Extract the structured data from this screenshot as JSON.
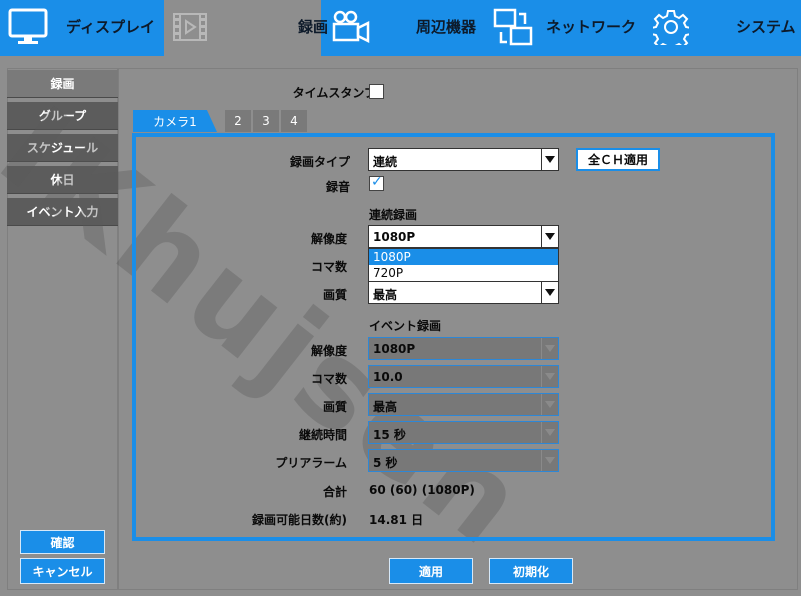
{
  "topbar": {
    "tabs": [
      {
        "label": "ディスプレイ",
        "icon": "monitor-icon"
      },
      {
        "label": "録画",
        "icon": "film-icon"
      },
      {
        "label": "周辺機器",
        "icon": "camera-icon"
      },
      {
        "label": "ネットワーク",
        "icon": "network-icon"
      },
      {
        "label": "システム",
        "icon": "gear-icon"
      }
    ],
    "active": "録画",
    "accent": "#1a8ee8"
  },
  "sidebar": {
    "items": [
      {
        "label": "録画"
      },
      {
        "label": "グループ"
      },
      {
        "label": "スケジュール"
      },
      {
        "label": "休日"
      },
      {
        "label": "イベント入力"
      }
    ],
    "confirm_label": "確認",
    "cancel_label": "キャンセル"
  },
  "main": {
    "timestamp_label": "タイムスタンプ",
    "timestamp_checked": false,
    "camera_tabs": [
      "カメラ1",
      "2",
      "3",
      "4"
    ],
    "record_type_label": "録画タイプ",
    "record_type_value": "連続",
    "apply_all_label": "全ＣＨ適用",
    "audio_label": "録音",
    "audio_checked": true,
    "continuous": {
      "heading": "連続録画",
      "resolution_label": "解像度",
      "resolution_value": "1080P",
      "resolution_options": [
        "1080P",
        "720P"
      ],
      "fps_label": "コマ数",
      "quality_label": "画質",
      "quality_value": "最高"
    },
    "event": {
      "heading": "イベント録画",
      "resolution_label": "解像度",
      "resolution_value": "1080P",
      "fps_label": "コマ数",
      "fps_value": "10.0",
      "quality_label": "画質",
      "quality_value": "最高",
      "duration_label": "継続時間",
      "duration_value": "15 秒",
      "prealarm_label": "プリアラーム",
      "prealarm_value": "5 秒"
    },
    "total_label": "合計",
    "total_value": "60 (60) (1080P)",
    "days_label": "録画可能日数(約)",
    "days_value": "14.81 日",
    "apply_label": "適用",
    "reset_label": "初期化"
  },
  "watermark": "IKhujsen"
}
